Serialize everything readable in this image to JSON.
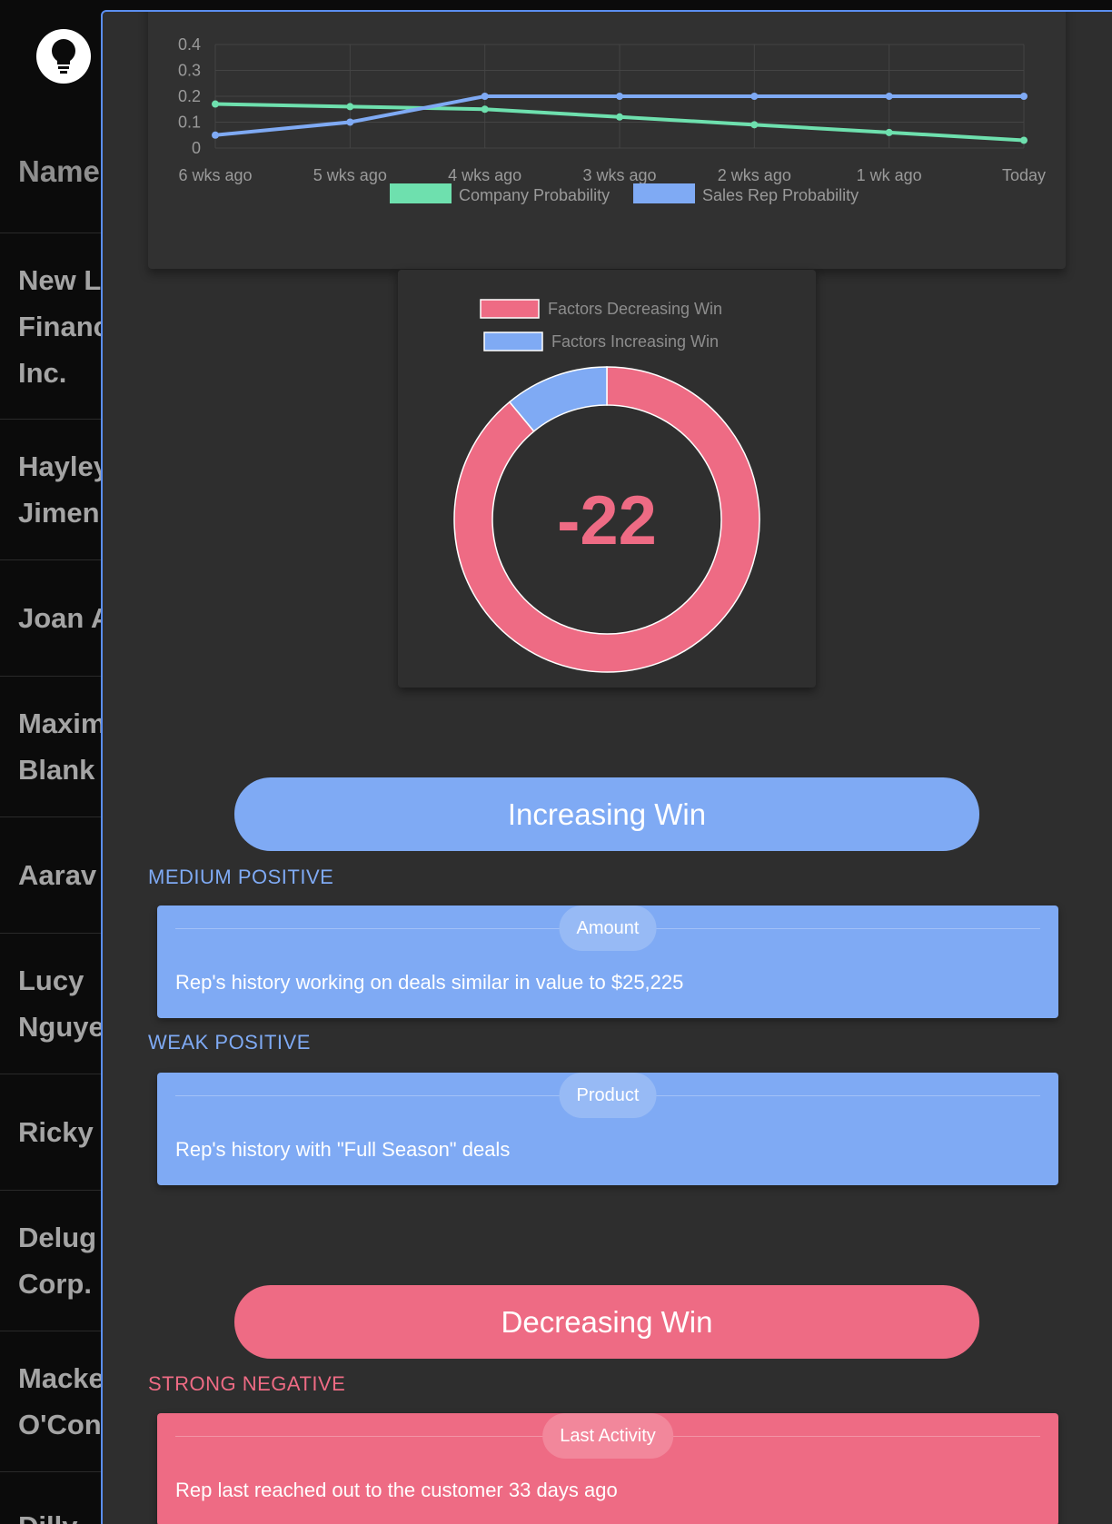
{
  "background_list": {
    "header": "Name",
    "rows": [
      "New L\nFinanc\nInc.",
      "Hayley\nJimen",
      "Joan A",
      "Maxim\nBlank",
      "Aarav",
      "Lucy\nNguye",
      "Ricky",
      "Delug\nCorp.",
      "Macke\nO'Con",
      "Dilly"
    ]
  },
  "line_chart": {
    "chart_data": {
      "type": "line",
      "categories": [
        "6 wks ago",
        "5 wks ago",
        "4 wks ago",
        "3 wks ago",
        "2 wks ago",
        "1 wk ago",
        "Today"
      ],
      "series": [
        {
          "name": "Company Probability",
          "color": "#6ee0ae",
          "values": [
            0.17,
            0.16,
            0.15,
            0.12,
            0.09,
            0.06,
            0.03
          ]
        },
        {
          "name": "Sales Rep Probability",
          "color": "#7faaf4",
          "values": [
            0.05,
            0.1,
            0.2,
            0.2,
            0.2,
            0.2,
            0.2
          ]
        }
      ],
      "y_ticks": [
        "0",
        "0.1",
        "0.2",
        "0.3",
        "0.4"
      ],
      "ylim": [
        0,
        0.4
      ],
      "grid": true,
      "legend": "bottom"
    }
  },
  "donut_chart": {
    "chart_data": {
      "type": "pie",
      "labels": [
        "Factors Decreasing Win",
        "Factors Increasing Win"
      ],
      "values": [
        89,
        11
      ],
      "colors": [
        "#ee6b84",
        "#7faaf4"
      ],
      "center_label": "-22",
      "legend": "top"
    }
  },
  "increasing": {
    "title": "Increasing Win",
    "groups": [
      {
        "strength": "MEDIUM POSITIVE",
        "category": "Amount",
        "description": "Rep's history working on deals similar in value to $25,225"
      },
      {
        "strength": "WEAK POSITIVE",
        "category": "Product",
        "description": "Rep's history with \"Full Season\" deals"
      }
    ]
  },
  "decreasing": {
    "title": "Decreasing Win",
    "groups": [
      {
        "strength": "STRONG NEGATIVE",
        "category": "Last Activity",
        "description": "Rep last reached out to the customer 33 days ago"
      }
    ]
  },
  "colors": {
    "positive": "#7faaf4",
    "negative": "#ee6b84",
    "company_line": "#6ee0ae",
    "modal_border": "#5b8ef0"
  },
  "icons": {
    "logo": "lightbulb-icon"
  }
}
